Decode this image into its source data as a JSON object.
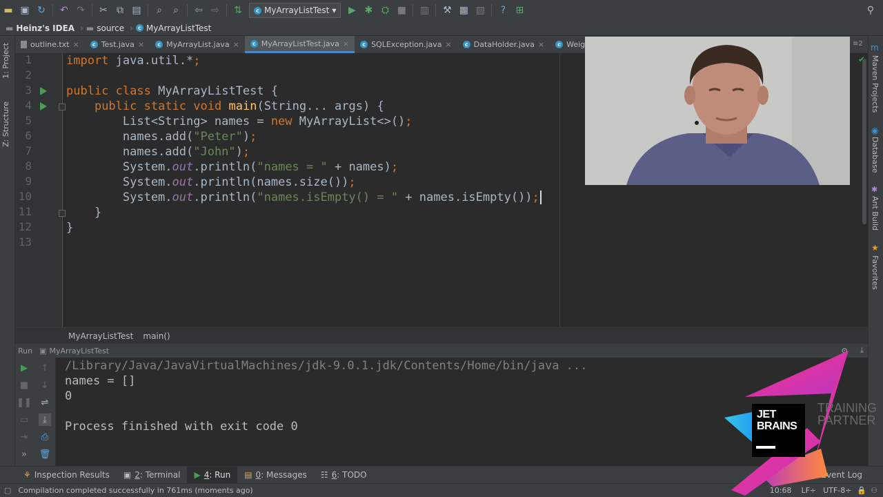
{
  "toolbar": {
    "run_config": "MyArrayListTest"
  },
  "navbar": {
    "crumbs": [
      "Heinz's IDEA",
      "source",
      "MyArrayListTest"
    ]
  },
  "tabs": [
    {
      "label": "outline.txt",
      "icon": "text-file-icon"
    },
    {
      "label": "Test.java",
      "icon": "class-icon"
    },
    {
      "label": "MyArrayList.java",
      "icon": "class-icon"
    },
    {
      "label": "MyArrayListTest.java",
      "icon": "class-icon",
      "active": true
    },
    {
      "label": "SQLException.java",
      "icon": "class-icon"
    },
    {
      "label": "DataHolder.java",
      "icon": "class-icon"
    },
    {
      "label": "Weig",
      "icon": "class-icon"
    }
  ],
  "tabs_overflow": "≡2",
  "left_strip": {
    "project": "1: Project",
    "structure": "Z: Structure"
  },
  "right_strip": {
    "maven": "Maven Projects",
    "database": "Database",
    "ant": "Ant Build",
    "favorites": "Favorites"
  },
  "editor": {
    "line_numbers": [
      "1",
      "2",
      "3",
      "4",
      "5",
      "6",
      "7",
      "8",
      "9",
      "10",
      "11",
      "12",
      "13"
    ],
    "lines": [
      "import java.util.*;",
      "",
      "public class MyArrayListTest {",
      "    public static void main(String... args) {",
      "        List<String> names = new MyArrayList<>();",
      "        names.add(\"Peter\");",
      "        names.add(\"John\");",
      "        System.out.println(\"names = \" + names);",
      "        System.out.println(names.size());",
      "        System.out.println(\"names.isEmpty() = \" + names.isEmpty());",
      "    }",
      "}",
      ""
    ]
  },
  "editor_breadcrumb": [
    "MyArrayListTest",
    "main()"
  ],
  "run_panel": {
    "title": "Run",
    "config": "MyArrayListTest",
    "output": [
      "/Library/Java/JavaVirtualMachines/jdk-9.0.1.jdk/Contents/Home/bin/java ...",
      "names = []",
      "0",
      "",
      "Process finished with exit code 0"
    ]
  },
  "bottom_tabs": {
    "inspection": "Inspection Results",
    "terminal_num": "2",
    "terminal": ": Terminal",
    "run_num": "4",
    "run": ": Run",
    "messages_num": "0",
    "messages": ": Messages",
    "todo_num": "6",
    "todo": ": TODO",
    "event_log": "Event Log"
  },
  "status": {
    "message": "Compilation completed successfully in 761ms (moments ago)",
    "position": "10:68",
    "line_sep": "LF÷",
    "encoding": "UTF-8÷"
  },
  "jetbrains": {
    "line1": "JET",
    "line2": "BRAINS",
    "line3": "TRAINING",
    "line4": "PARTNER"
  },
  "colors": {
    "background": "#2b2b2b",
    "keyword": "#cc7832",
    "string": "#6a8759",
    "field": "#9876aa",
    "accent": "#4a88c7"
  }
}
